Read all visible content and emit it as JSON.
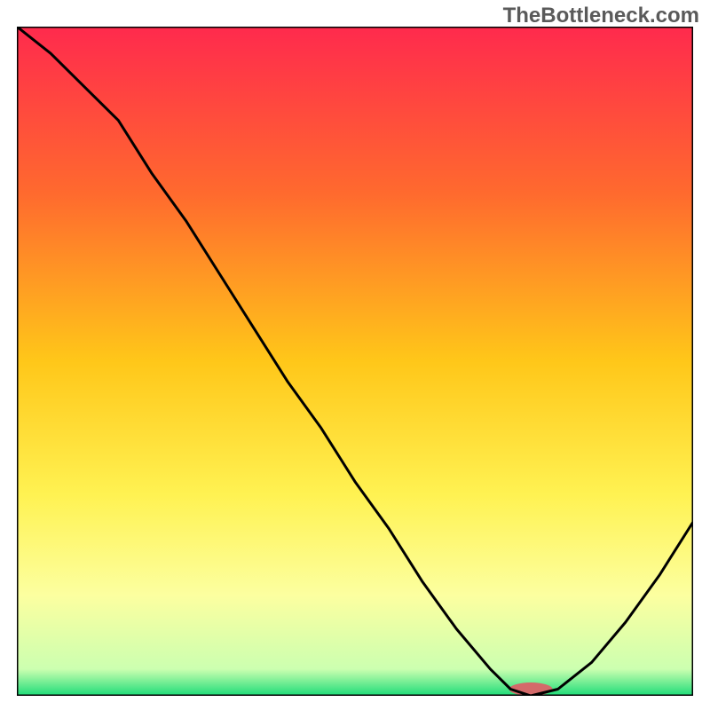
{
  "watermark": "TheBottleneck.com",
  "chart_data": {
    "type": "line",
    "title": "",
    "xlabel": "",
    "ylabel": "",
    "xlim": [
      0,
      100
    ],
    "ylim": [
      0,
      100
    ],
    "x": [
      0,
      5,
      10,
      15,
      20,
      25,
      30,
      35,
      40,
      45,
      50,
      55,
      60,
      65,
      70,
      73,
      76,
      80,
      85,
      90,
      95,
      100
    ],
    "values": [
      100,
      96,
      91,
      86,
      78,
      71,
      63,
      55,
      47,
      40,
      32,
      25,
      17,
      10,
      4,
      1,
      0,
      1,
      5,
      11,
      18,
      26
    ],
    "background_gradient_stops": [
      {
        "offset": 0,
        "color": "#ff2a4d"
      },
      {
        "offset": 25,
        "color": "#ff6a2e"
      },
      {
        "offset": 50,
        "color": "#ffc719"
      },
      {
        "offset": 70,
        "color": "#fff252"
      },
      {
        "offset": 85,
        "color": "#fcffa0"
      },
      {
        "offset": 96,
        "color": "#ccffb0"
      },
      {
        "offset": 100,
        "color": "#1cdc78"
      }
    ],
    "marker": {
      "x": 76,
      "rx_pct": 3.2,
      "ry_pct": 1.0,
      "color": "#d46a6a"
    }
  }
}
